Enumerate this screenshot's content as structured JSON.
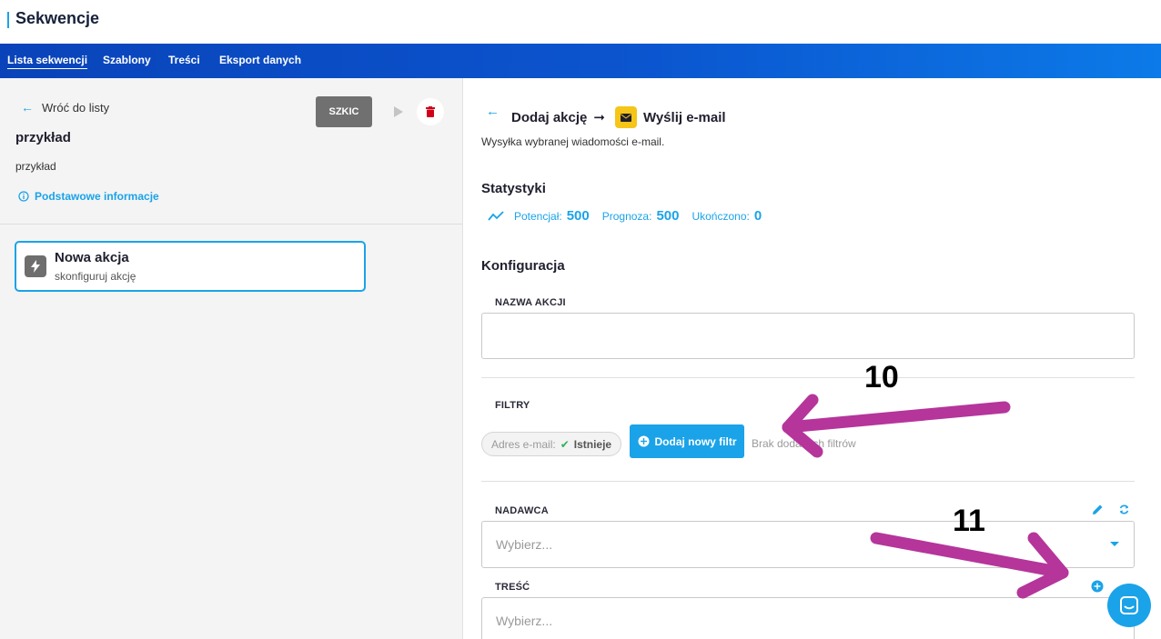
{
  "app": {
    "title": "Sekwencje"
  },
  "nav": {
    "tabs": [
      "Lista sekwencji",
      "Szablony",
      "Treści",
      "Eksport danych"
    ],
    "active_index": 0
  },
  "left": {
    "back_label": "Wróć do listy",
    "status_button": "SZKIC",
    "sequence_name": "przykład",
    "sequence_description": "przykład",
    "info_link": "Podstawowe informacje",
    "action_card": {
      "title": "Nowa akcja",
      "subtitle": "skonfiguruj akcję"
    }
  },
  "right": {
    "breadcrumb": {
      "first": "Dodaj akcję",
      "separator": "➞",
      "second": "Wyślij e-mail"
    },
    "subtitle": "Wysyłka wybranej wiadomości e-mail.",
    "stats": {
      "heading": "Statystyki",
      "items": [
        {
          "label": "Potencjał:",
          "value": "500"
        },
        {
          "label": "Prognoza:",
          "value": "500"
        },
        {
          "label": "Ukończono:",
          "value": "0"
        }
      ]
    },
    "config": {
      "heading": "Konfiguracja",
      "action_name_label": "NAZWA AKCJI",
      "action_name_value": "",
      "filters_label": "FILTRY",
      "filter_chip": {
        "field": "Adres e-mail:",
        "check": "✔",
        "value": "Istnieje"
      },
      "add_filter_button": "Dodaj nowy filtr",
      "no_filters_text": "Brak dodanych filtrów",
      "sender_label": "NADAWCA",
      "sender_placeholder": "Wybierz...",
      "content_label": "TREŚĆ",
      "content_placeholder": "Wybierz..."
    }
  },
  "annotations": {
    "callout_1": "10",
    "callout_2": "11",
    "arrow_color": "#b5359b"
  },
  "colors": {
    "accent": "#1aa3e8",
    "nav_start": "#0a43b9",
    "nav_end": "#0c7ae8",
    "draft_button": "#707070",
    "mail_badge": "#f5c518",
    "delete": "#d0021b"
  }
}
